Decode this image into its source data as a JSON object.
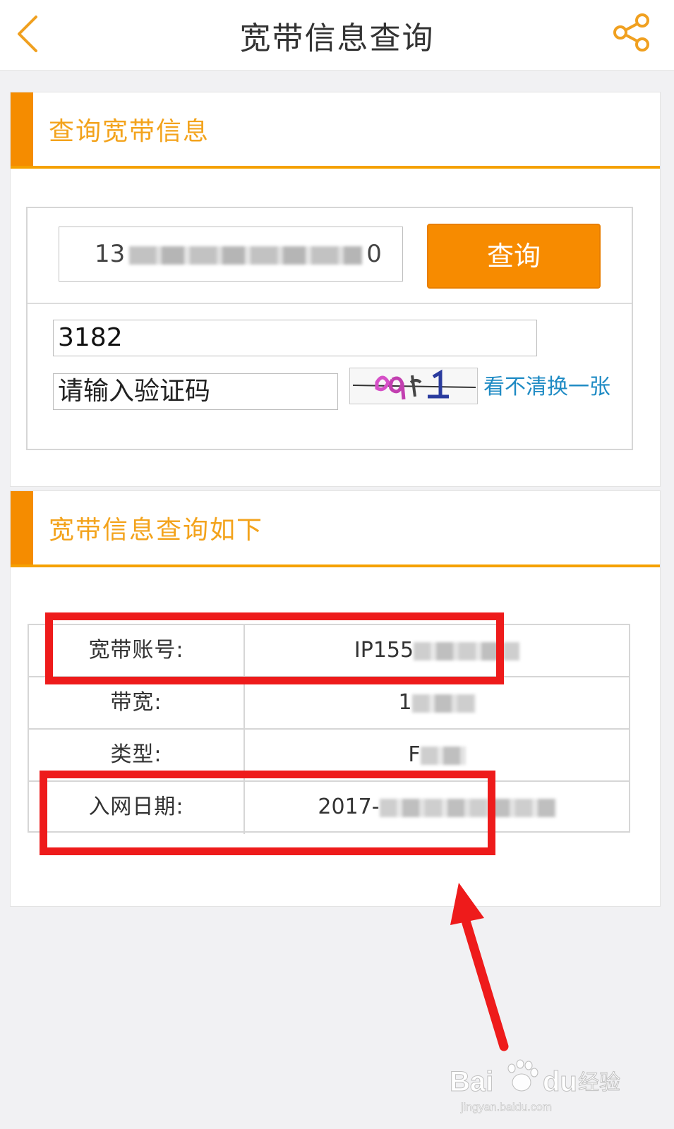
{
  "nav": {
    "title": "宽带信息查询"
  },
  "query_panel": {
    "title": "查询宽带信息",
    "phone_input_prefix": "13",
    "phone_input_suffix": "0",
    "query_button_label": "查询",
    "account_input_value": "3182",
    "captcha_input_placeholder": "请输入验证码",
    "captcha_refresh_label": "看不清换一张"
  },
  "result_panel": {
    "title": "宽带信息查询如下",
    "rows": [
      {
        "label": "宽带账号:",
        "value_visible": "IP155"
      },
      {
        "label": "带宽:",
        "value_visible": "1"
      },
      {
        "label": "类型:",
        "value_visible": "F"
      },
      {
        "label": "入网日期:",
        "value_visible": "2017-"
      }
    ]
  },
  "colors": {
    "accent_orange": "#f78b00",
    "header_text_orange": "#f3a31c",
    "link_blue": "#1f8bc4",
    "annotation_red": "#ee1b1b"
  },
  "icons": [
    "chevron-left-icon",
    "share-icon"
  ]
}
